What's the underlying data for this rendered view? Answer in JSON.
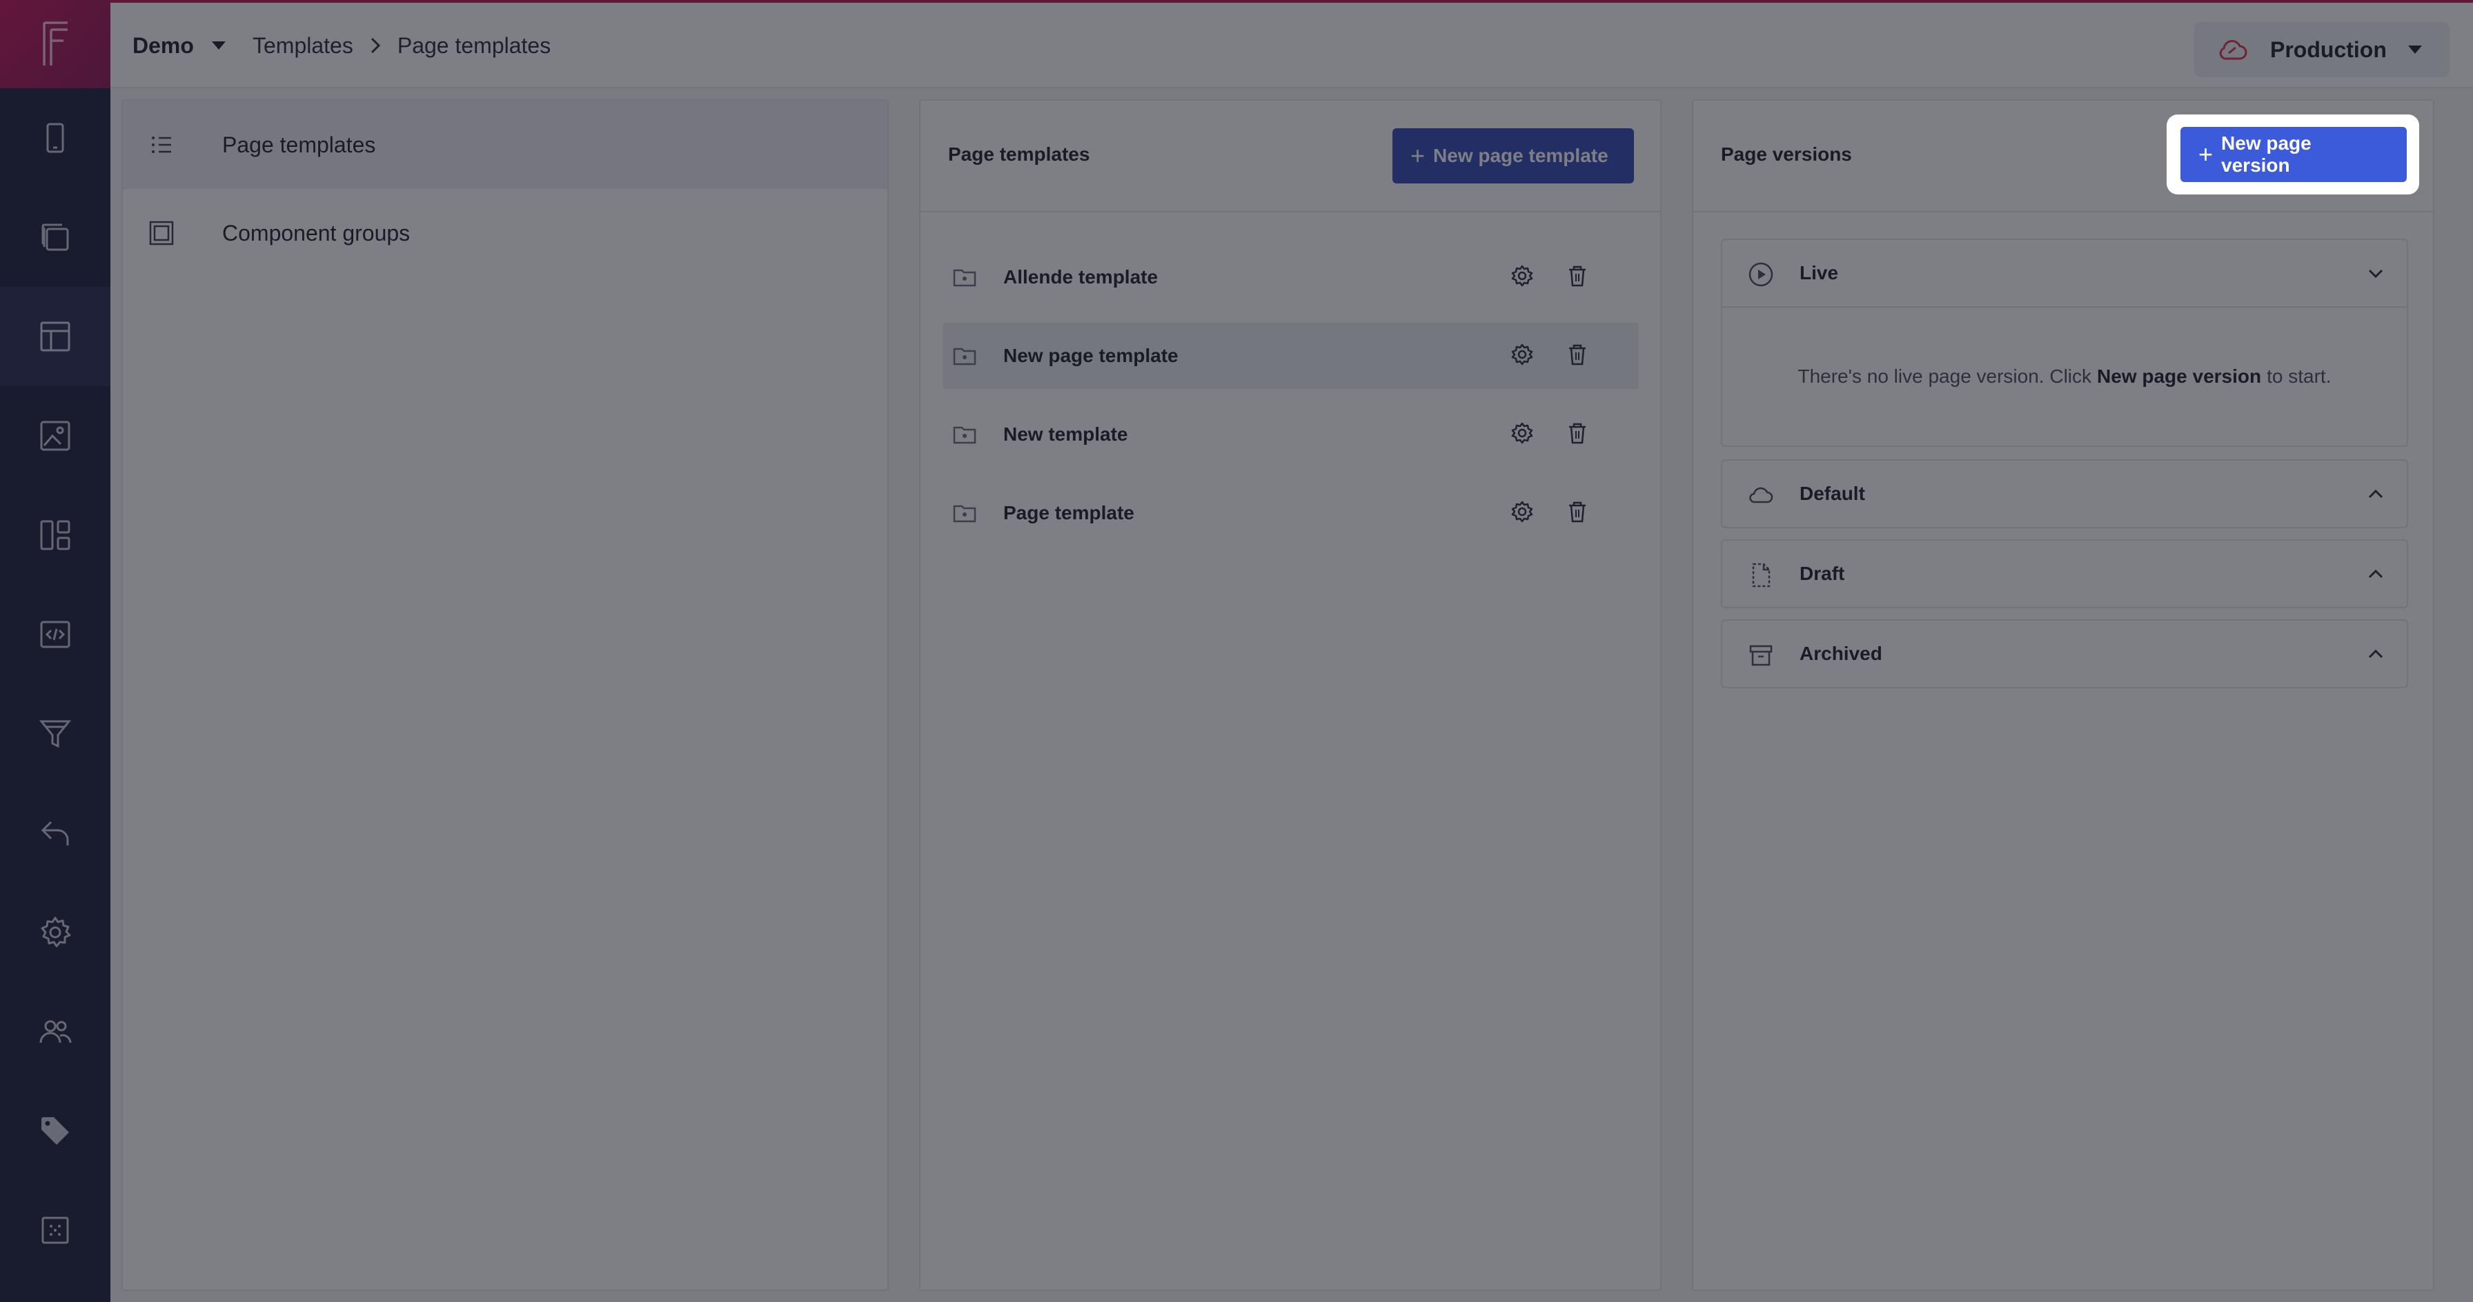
{
  "app": {
    "project": "Demo",
    "environment": "Production",
    "brand_color": "#c2185b",
    "rail_items": [
      {
        "name": "device-icon"
      },
      {
        "name": "copy-icon"
      },
      {
        "name": "layout-icon",
        "active": true
      },
      {
        "name": "image-icon"
      },
      {
        "name": "dashboard-icon"
      },
      {
        "name": "code-icon"
      },
      {
        "name": "filter-icon"
      },
      {
        "name": "undo-icon"
      },
      {
        "name": "settings-icon"
      },
      {
        "name": "users-icon"
      },
      {
        "name": "tag-icon"
      },
      {
        "name": "grid-icon"
      }
    ]
  },
  "breadcrumb": {
    "root": "Templates",
    "current": "Page templates"
  },
  "nav": {
    "items": [
      {
        "label": "Page templates",
        "selected": true
      },
      {
        "label": "Component groups",
        "selected": false
      }
    ]
  },
  "templates": {
    "title": "Page templates",
    "new_button": "New page template",
    "rows": [
      {
        "name": "Allende template"
      },
      {
        "name": "New page template",
        "selected": true
      },
      {
        "name": "New template"
      },
      {
        "name": "Page template"
      }
    ]
  },
  "versions": {
    "title": "Page versions",
    "new_button": "New page version",
    "sections": {
      "live": {
        "label": "Live",
        "empty_prefix": "There's no live page version. Click",
        "empty_link": "New page version",
        "empty_suffix": "to start."
      },
      "default": {
        "label": "Default"
      },
      "draft": {
        "label": "Draft"
      },
      "archived": {
        "label": "Archived"
      }
    }
  }
}
